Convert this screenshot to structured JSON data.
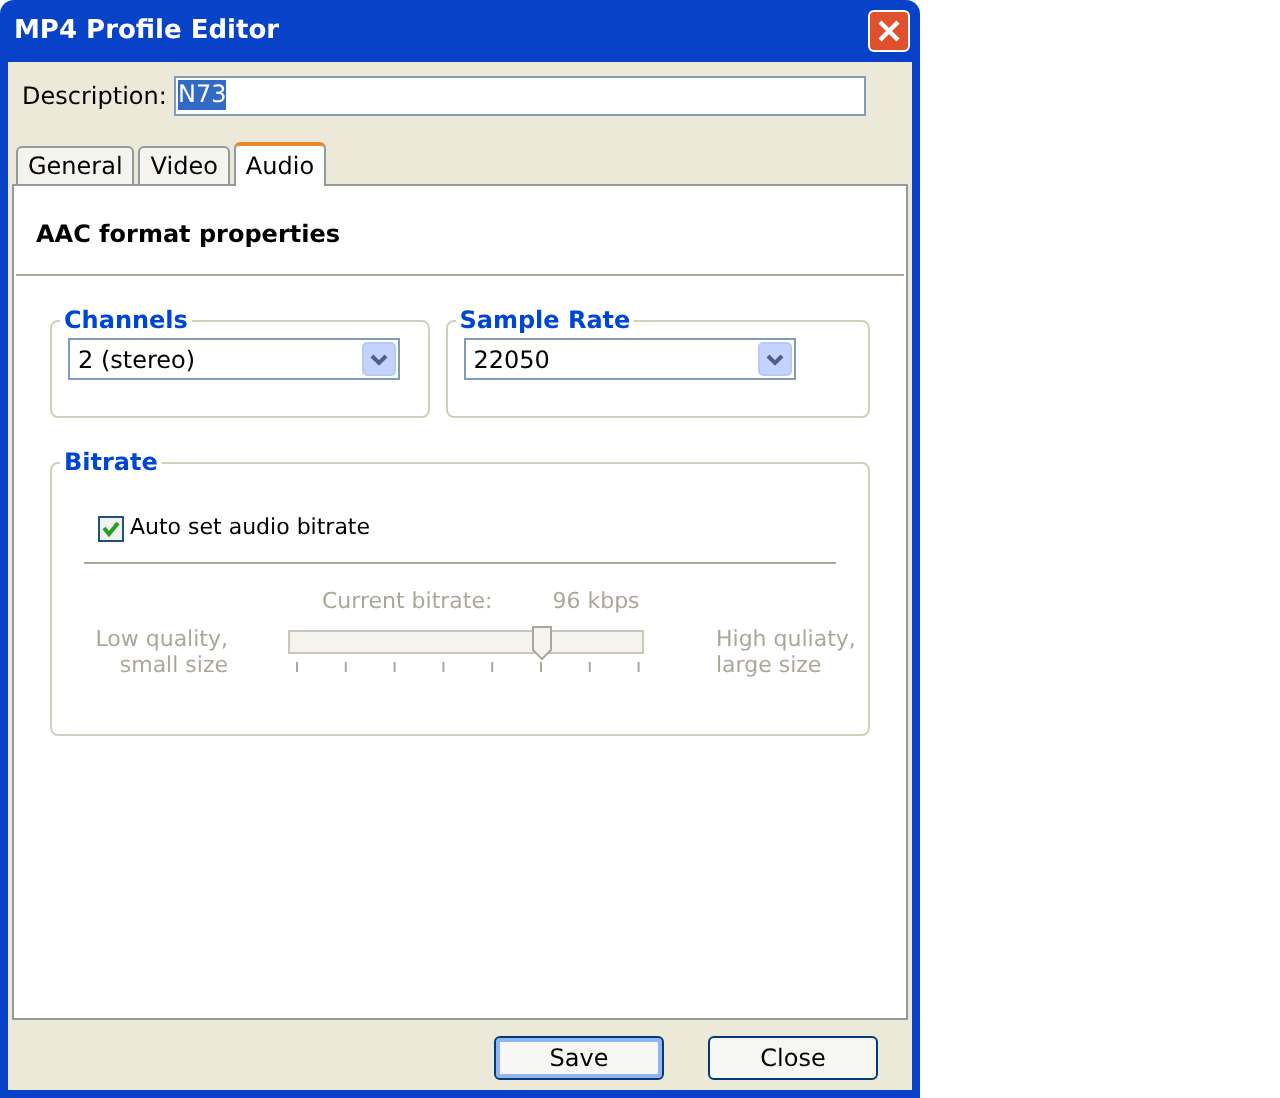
{
  "window": {
    "title": "MP4 Profile Editor"
  },
  "description": {
    "label": "Description:",
    "value": "N73",
    "selected_text": true
  },
  "tabs": [
    {
      "label": "General",
      "selected": false
    },
    {
      "label": "Video",
      "selected": false
    },
    {
      "label": "Audio",
      "selected": true
    }
  ],
  "section_title": "AAC format properties",
  "channels": {
    "title": "Channels",
    "value": "2 (stereo)"
  },
  "sample_rate": {
    "title": "Sample Rate",
    "value": "22050"
  },
  "bitrate": {
    "title": "Bitrate",
    "auto": {
      "label": "Auto set audio bitrate",
      "checked": true
    },
    "current_label": "Current bitrate:",
    "current_value": "96",
    "unit": "kbps",
    "low_label": "Low quality,",
    "low_sub": "small size",
    "high_label": "High quliaty,",
    "high_sub": "large size",
    "slider": {
      "level": 0.71,
      "disabled": true
    }
  },
  "buttons": [
    {
      "label": "Save",
      "kind": "default"
    },
    {
      "label": "Close",
      "kind": "normal"
    }
  ]
}
